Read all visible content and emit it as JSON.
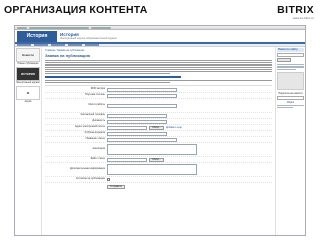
{
  "slide": {
    "title": "Организация контента",
    "brand": "BITRIX",
    "subtitle": "www.1c-bitrix.ru"
  },
  "site": {
    "logo_text": "История",
    "title": "История",
    "subtitle": "Электронный научно-образовательный журнал"
  },
  "main": {
    "breadcrumb": "Главная / Заявка на публикацию",
    "heading": "Заявка на публикацию"
  },
  "left": {
    "banner_1": "Новости",
    "label_1": "Новые публикации",
    "banner_2": "ИСТОРИЯ",
    "label_2": "Электронный журнал",
    "banner_3": "Ж",
    "label_3": "Архив"
  },
  "form": {
    "fields": [
      {
        "label": "ФИО автора"
      },
      {
        "label": "Научная степень"
      },
      {
        "label": "Место работы"
      },
      {
        "label": "Контактный телефон"
      },
      {
        "label": "Должность"
      },
      {
        "label": "Адрес электронной почты"
      },
      {
        "label": "Рубрика журнала"
      },
      {
        "label": "Название статьи"
      },
      {
        "label": "Аннотация"
      },
      {
        "label": "Файл статьи"
      },
      {
        "label": "Дополнительная информация"
      },
      {
        "label": "Согласие на публикацию"
      }
    ],
    "browse_label": "Обзор...",
    "add_hint": "Добавить ещё",
    "submit_label": "Отправить"
  },
  "right": {
    "box_title": "Поиск по сайту",
    "text_1": "Подписка на новости",
    "text_2": "Опрос"
  }
}
